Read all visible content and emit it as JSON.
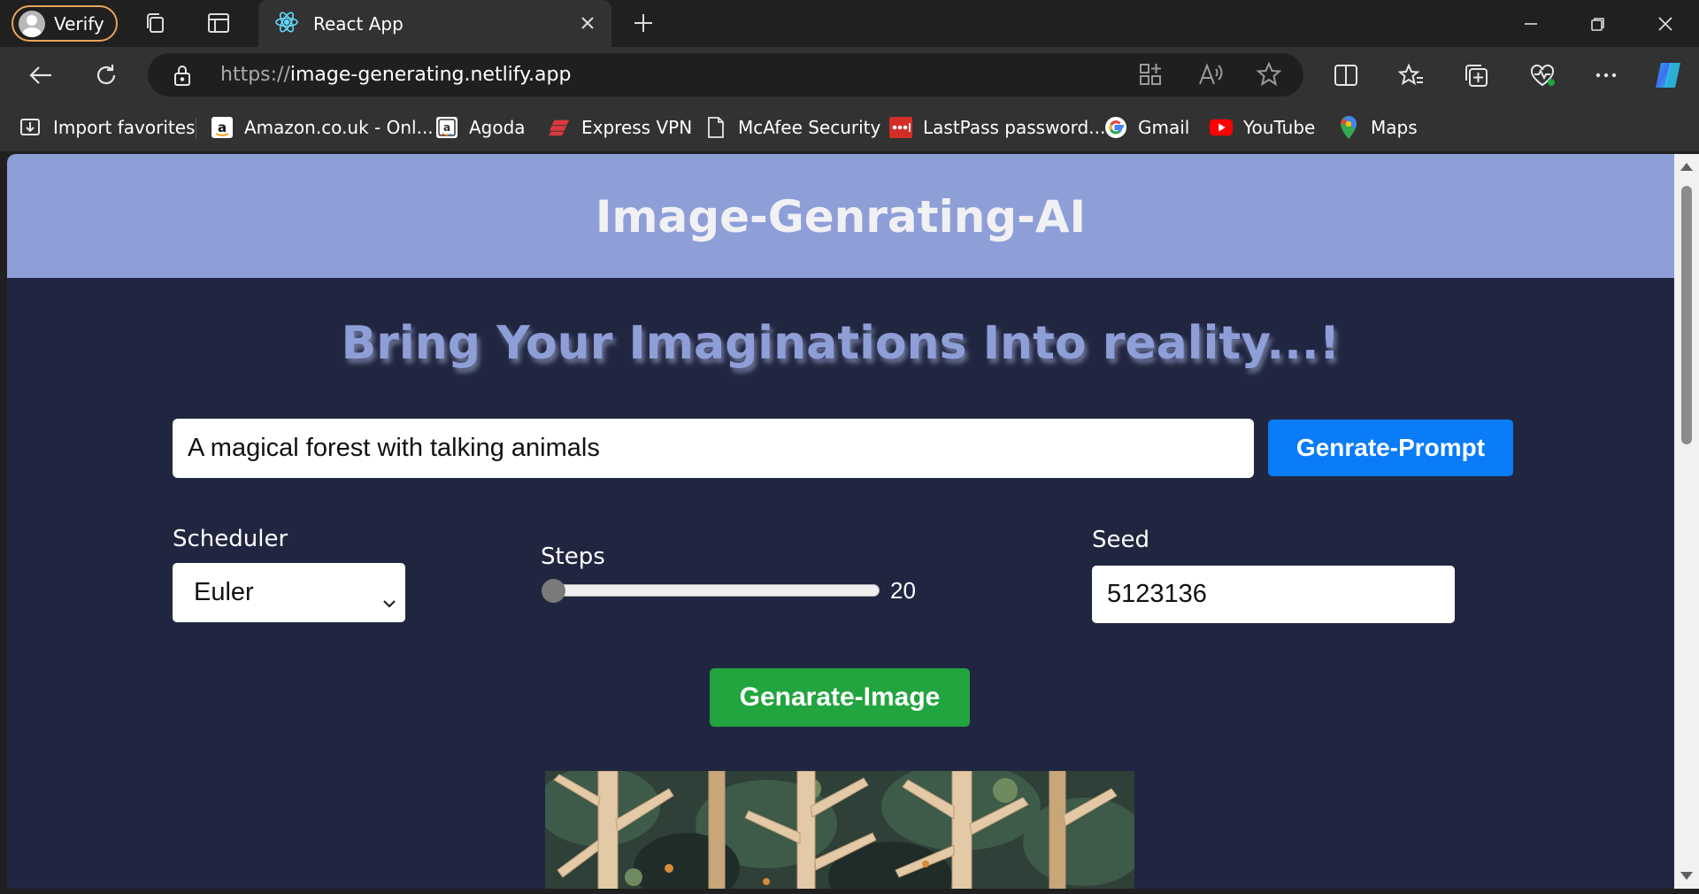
{
  "browser": {
    "profile_label": "Verify",
    "tab_title": "React App",
    "url_protocol": "https://",
    "url_host": "image-generating.netlify.app",
    "bookmarks": [
      {
        "label": "Import favorites",
        "icon": "import-favorites-icon"
      },
      {
        "label": "Amazon.co.uk - Onl...",
        "icon": "amazon-icon"
      },
      {
        "label": "Agoda",
        "icon": "agoda-icon"
      },
      {
        "label": "Express VPN",
        "icon": "expressvpn-icon"
      },
      {
        "label": "McAfee Security",
        "icon": "page-icon"
      },
      {
        "label": "LastPass password...",
        "icon": "lastpass-icon"
      },
      {
        "label": "Gmail",
        "icon": "google-icon"
      },
      {
        "label": "YouTube",
        "icon": "youtube-icon"
      },
      {
        "label": "Maps",
        "icon": "maps-icon"
      }
    ]
  },
  "site": {
    "title": "Image-Genrating-AI",
    "tagline": "Bring Your Imaginations Into reality...!",
    "prompt_value": "A magical forest with talking animals",
    "prompt_button": "Genrate-Prompt",
    "scheduler_label": "Scheduler",
    "scheduler_value": "Euler",
    "steps_label": "Steps",
    "steps_value": "20",
    "steps_fraction": 0.0,
    "seed_label": "Seed",
    "seed_value": "5123136",
    "generate_button": "Genarate-Image"
  },
  "colors": {
    "header_bg": "#8e9fd8",
    "page_bg": "#212640",
    "prompt_button_bg": "#0a7cf7",
    "generate_button_bg": "#22a43f"
  }
}
